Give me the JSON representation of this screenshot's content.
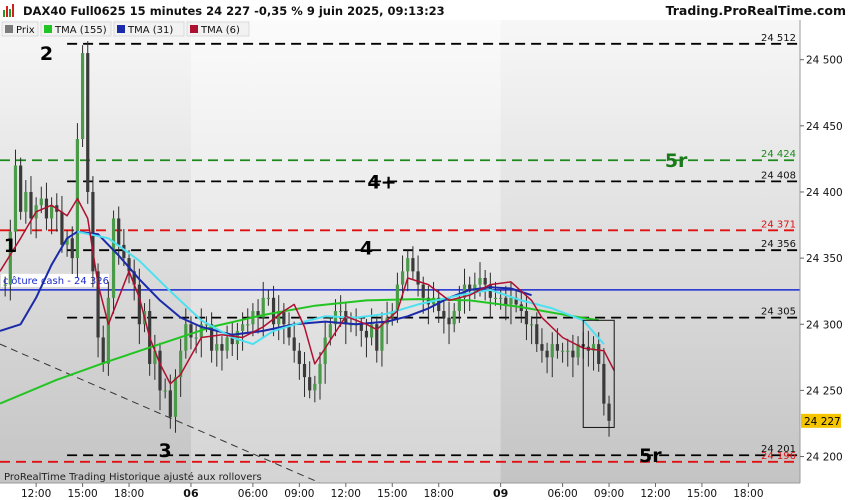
{
  "header": {
    "title": "DAX40 Full0625 15 minutes 24 227 -0,35 % 9 juin 2025, 09:13:23",
    "brand": "Trading.ProRealTime.com"
  },
  "legend": [
    {
      "label": "Prix",
      "color": "#7a7a7a"
    },
    {
      "label": "TMA (155)",
      "color": "#22c422"
    },
    {
      "label": "TMA (31)",
      "color": "#1a2aa8"
    },
    {
      "label": "TMA (6)",
      "color": "#b01030"
    }
  ],
  "footer_note": "ProRealTime Trading  Historique ajusté aux rollovers",
  "annotations": [
    {
      "text": "2",
      "x": 8,
      "y": 24505,
      "color": "#000000"
    },
    {
      "text": "1",
      "x": 1,
      "y": 24360,
      "color": "#000000"
    },
    {
      "text": "3",
      "x": 31,
      "y": 24205,
      "color": "#000000"
    },
    {
      "text": "4",
      "x": 70,
      "y": 24358,
      "color": "#000000"
    },
    {
      "text": "4+",
      "x": 73,
      "y": 24408,
      "color": "#000000"
    },
    {
      "text": "5r",
      "x": 130,
      "y": 24424,
      "color": "#1a7a1a"
    },
    {
      "text": "5r",
      "x": 125,
      "y": 24201,
      "color": "#000000"
    }
  ],
  "chart_data": {
    "type": "line",
    "title": "DAX40 Full0625 15 minutes",
    "ylim": [
      24180,
      24530
    ],
    "xlim": [
      -1,
      154
    ],
    "yticks": [
      24200,
      24250,
      24300,
      24350,
      24400,
      24450,
      24500
    ],
    "xticks": [
      {
        "x": 6,
        "label": "12:00",
        "bold": false
      },
      {
        "x": 15,
        "label": "15:00",
        "bold": false
      },
      {
        "x": 24,
        "label": "18:00",
        "bold": false
      },
      {
        "x": 36,
        "label": "06",
        "bold": true
      },
      {
        "x": 48,
        "label": "06:00",
        "bold": false
      },
      {
        "x": 57,
        "label": "09:00",
        "bold": false
      },
      {
        "x": 66,
        "label": "12:00",
        "bold": false
      },
      {
        "x": 75,
        "label": "15:00",
        "bold": false
      },
      {
        "x": 84,
        "label": "18:00",
        "bold": false
      },
      {
        "x": 96,
        "label": "09",
        "bold": true
      },
      {
        "x": 108,
        "label": "06:00",
        "bold": false
      },
      {
        "x": 117,
        "label": "09:00",
        "bold": false
      },
      {
        "x": 126,
        "label": "12:00",
        "bold": false
      },
      {
        "x": 135,
        "label": "15:00",
        "bold": false
      },
      {
        "x": 144,
        "label": "18:00",
        "bold": false
      }
    ],
    "session_shading": [
      [
        -1,
        36
      ],
      [
        96,
        154
      ]
    ],
    "levels": [
      {
        "value": 24512,
        "label": "24 512",
        "style": "dash",
        "color": "#000000",
        "start": 12
      },
      {
        "value": 24424,
        "label": "24 424",
        "style": "dash",
        "color": "#1a8a1a",
        "start": -1
      },
      {
        "value": 24408,
        "label": "24 408",
        "style": "dash",
        "color": "#000000",
        "start": 12
      },
      {
        "value": 24371,
        "label": "24 371",
        "style": "dash",
        "color": "#e01010",
        "start": -1
      },
      {
        "value": 24356,
        "label": "24 356",
        "style": "dash",
        "color": "#000000",
        "start": 12
      },
      {
        "value": 24326,
        "label": "clôture cash -  24 326",
        "style": "solid",
        "color": "#1a2ad0",
        "start": -1
      },
      {
        "value": 24305,
        "label": "24 305",
        "style": "dash",
        "color": "#000000",
        "start": 12
      },
      {
        "value": 24201,
        "label": "24 201",
        "style": "dash",
        "color": "#000000",
        "start": 12
      },
      {
        "value": 24196,
        "label": "24 196",
        "style": "dash",
        "color": "#e01010",
        "start": -1
      }
    ],
    "last_price": {
      "value": 24227,
      "label": "24 227"
    },
    "highlight_box": {
      "x0": 112,
      "x1": 118,
      "y0": 24222,
      "y1": 24303
    },
    "trendline": {
      "x0": -1,
      "y0": 24285,
      "x1": 64,
      "y1": 24175
    },
    "price": [
      24330,
      24370,
      24420,
      24385,
      24400,
      24380,
      24390,
      24395,
      24380,
      24390,
      24385,
      24360,
      24365,
      24350,
      24440,
      24505,
      24400,
      24340,
      24290,
      24270,
      24320,
      24380,
      24360,
      24350,
      24340,
      24330,
      24300,
      24310,
      24270,
      24280,
      24250,
      24250,
      24230,
      24260,
      24280,
      24300,
      24290,
      24290,
      24300,
      24300,
      24280,
      24285,
      24280,
      24290,
      24285,
      24295,
      24300,
      24300,
      24310,
      24305,
      24320,
      24320,
      24300,
      24310,
      24300,
      24290,
      24280,
      24270,
      24260,
      24250,
      24255,
      24270,
      24290,
      24300,
      24310,
      24310,
      24300,
      24300,
      24300,
      24295,
      24290,
      24300,
      24280,
      24300,
      24305,
      24310,
      24330,
      24340,
      24350,
      24340,
      24330,
      24320,
      24315,
      24320,
      24310,
      24305,
      24300,
      24310,
      24320,
      24330,
      24325,
      24330,
      24335,
      24330,
      24320,
      24320,
      24320,
      24315,
      24320,
      24315,
      24310,
      24300,
      24300,
      24285,
      24280,
      24275,
      24285,
      24280,
      24280,
      24280,
      24275,
      24285,
      24283,
      24280,
      24285,
      24270,
      24240,
      24227
    ],
    "series": [
      {
        "name": "TMA (155)",
        "color": "#22c422",
        "width": 2,
        "points": [
          [
            -1,
            24240
          ],
          [
            10,
            24258
          ],
          [
            20,
            24272
          ],
          [
            30,
            24285
          ],
          [
            40,
            24298
          ],
          [
            50,
            24307
          ],
          [
            60,
            24314
          ],
          [
            70,
            24318
          ],
          [
            80,
            24319
          ],
          [
            90,
            24318
          ],
          [
            100,
            24313
          ],
          [
            110,
            24306
          ],
          [
            115,
            24303
          ]
        ]
      },
      {
        "name": "TMA (31)",
        "color": "#1a2aa8",
        "width": 2,
        "points": [
          [
            -1,
            24295
          ],
          [
            3,
            24300
          ],
          [
            6,
            24320
          ],
          [
            9,
            24345
          ],
          [
            12,
            24365
          ],
          [
            14,
            24370
          ],
          [
            18,
            24368
          ],
          [
            22,
            24352
          ],
          [
            26,
            24334
          ],
          [
            30,
            24318
          ],
          [
            34,
            24305
          ],
          [
            38,
            24298
          ],
          [
            44,
            24292
          ],
          [
            50,
            24295
          ],
          [
            56,
            24300
          ],
          [
            62,
            24302
          ],
          [
            68,
            24300
          ],
          [
            74,
            24302
          ],
          [
            78,
            24306
          ],
          [
            82,
            24312
          ],
          [
            86,
            24320
          ],
          [
            90,
            24326
          ],
          [
            94,
            24328
          ],
          [
            98,
            24327
          ],
          [
            102,
            24322
          ]
        ]
      },
      {
        "name": "TMA (31) lead",
        "color": "#4de0f0",
        "width": 2,
        "points": [
          [
            14,
            24370
          ],
          [
            20,
            24365
          ],
          [
            26,
            24348
          ],
          [
            32,
            24325
          ],
          [
            38,
            24303
          ],
          [
            44,
            24290
          ],
          [
            48,
            24285
          ],
          [
            52,
            24295
          ],
          [
            58,
            24302
          ],
          [
            62,
            24306
          ],
          [
            68,
            24305
          ],
          [
            74,
            24308
          ],
          [
            80,
            24315
          ],
          [
            88,
            24322
          ],
          [
            94,
            24326
          ],
          [
            100,
            24318
          ],
          [
            106,
            24312
          ],
          [
            112,
            24303
          ],
          [
            116,
            24285
          ]
        ]
      },
      {
        "name": "TMA (6)",
        "color": "#b01030",
        "width": 1.5,
        "points": [
          [
            -1,
            24340
          ],
          [
            3,
            24365
          ],
          [
            6,
            24385
          ],
          [
            9,
            24390
          ],
          [
            12,
            24382
          ],
          [
            14,
            24395
          ],
          [
            16,
            24380
          ],
          [
            18,
            24330
          ],
          [
            20,
            24300
          ],
          [
            22,
            24320
          ],
          [
            24,
            24340
          ],
          [
            26,
            24320
          ],
          [
            28,
            24290
          ],
          [
            30,
            24270
          ],
          [
            32,
            24255
          ],
          [
            34,
            24262
          ],
          [
            38,
            24290
          ],
          [
            42,
            24292
          ],
          [
            46,
            24290
          ],
          [
            50,
            24298
          ],
          [
            54,
            24310
          ],
          [
            56,
            24315
          ],
          [
            58,
            24298
          ],
          [
            60,
            24270
          ],
          [
            62,
            24282
          ],
          [
            66,
            24306
          ],
          [
            70,
            24300
          ],
          [
            72,
            24296
          ],
          [
            76,
            24310
          ],
          [
            78,
            24335
          ],
          [
            82,
            24330
          ],
          [
            86,
            24318
          ],
          [
            90,
            24322
          ],
          [
            94,
            24330
          ],
          [
            98,
            24332
          ],
          [
            102,
            24318
          ],
          [
            104,
            24305
          ],
          [
            108,
            24290
          ],
          [
            112,
            24282
          ],
          [
            116,
            24280
          ],
          [
            118,
            24265
          ]
        ]
      }
    ]
  }
}
